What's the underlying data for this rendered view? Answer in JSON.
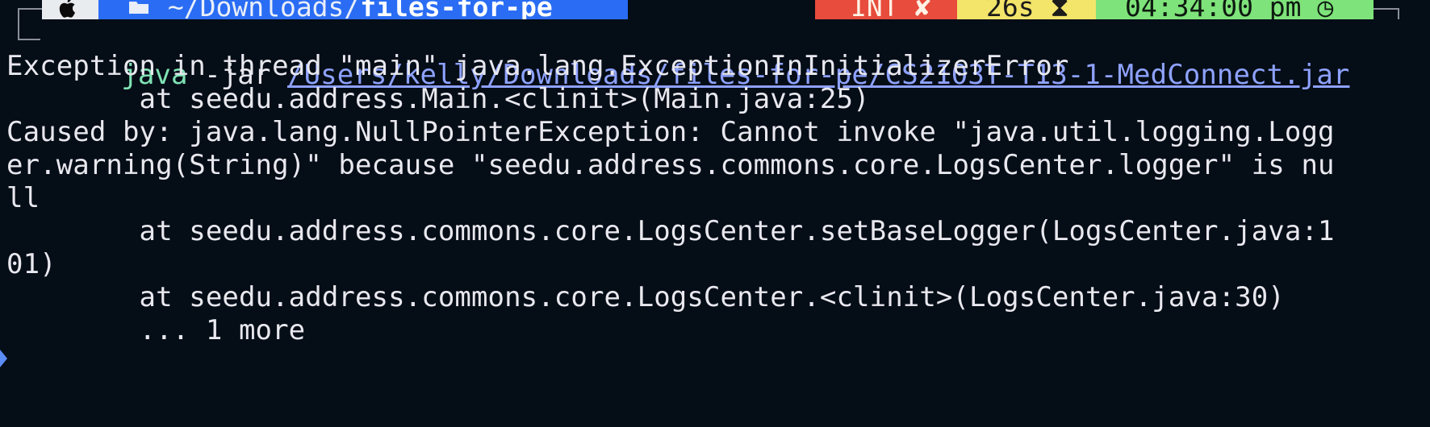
{
  "prompt": {
    "apple_icon": "apple-logo",
    "folder_icon": "folder-open",
    "path_prefix": "~/Downloads/",
    "path_current": "files-for-pe",
    "status": "INT",
    "status_icon": "x-mark",
    "duration": "26s",
    "duration_icon": "hourglass",
    "time": "04:34:00 pm",
    "time_icon": "clock",
    "colors": {
      "apple": "#e9ecef",
      "path": "#2a6df4",
      "status": "#e74c3c",
      "duration": "#f3e46a",
      "time": "#7ee37a"
    }
  },
  "command": {
    "program": "java",
    "flag": "-jar",
    "jar_path": "/Users/kelly/Downloads/files-for-pe/CS2103T-T13-1-MedConnect.jar"
  },
  "output": [
    "Exception in thread \"main\" java.lang.ExceptionInInitializerError",
    "        at seedu.address.Main.<clinit>(Main.java:25)",
    "Caused by: java.lang.NullPointerException: Cannot invoke \"java.util.logging.Logg",
    "er.warning(String)\" because \"seedu.address.commons.core.LogsCenter.logger\" is nu",
    "ll",
    "        at seedu.address.commons.core.LogsCenter.setBaseLogger(LogsCenter.java:1",
    "01)",
    "        at seedu.address.commons.core.LogsCenter.<clinit>(LogsCenter.java:30)",
    "        ... 1 more"
  ],
  "theme": {
    "background": "#050d17",
    "foreground": "#e8e8ee",
    "java_color": "#7fe3b4",
    "path_color": "#8ea2ff"
  }
}
